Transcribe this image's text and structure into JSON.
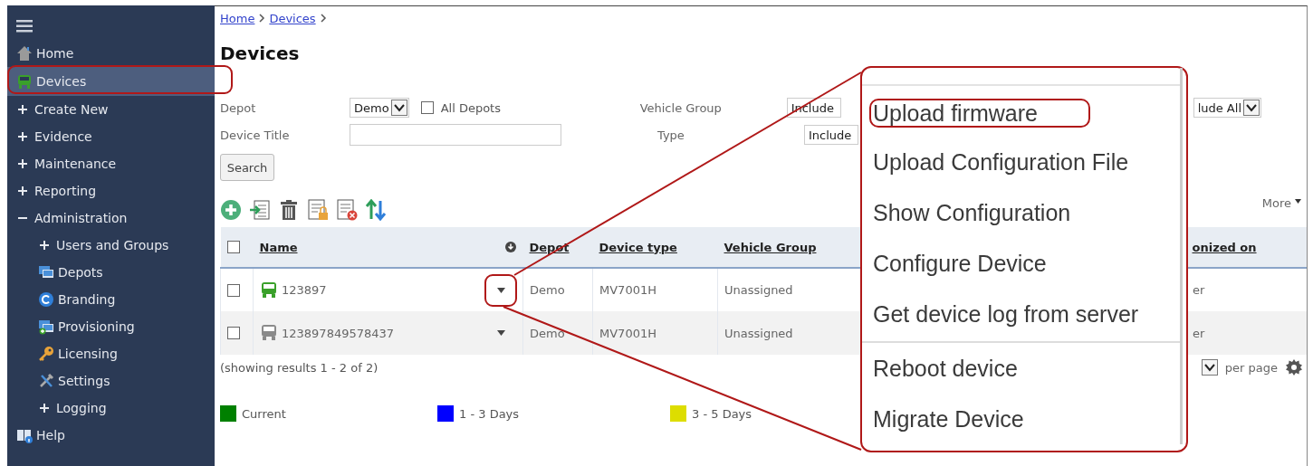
{
  "sidebar": {
    "items": [
      {
        "kind": "page",
        "label": "Home",
        "selected": false
      },
      {
        "kind": "page",
        "label": "Devices",
        "selected": true
      },
      {
        "kind": "folder",
        "label": "Create New",
        "expanded": false,
        "selected": false
      },
      {
        "kind": "folder",
        "label": "Evidence",
        "expanded": false,
        "selected": false
      },
      {
        "kind": "folder",
        "label": "Maintenance",
        "expanded": false,
        "selected": false
      },
      {
        "kind": "folder",
        "label": "Reporting",
        "expanded": false,
        "selected": false
      },
      {
        "kind": "folder",
        "label": "Administration",
        "expanded": true,
        "selected": false,
        "children": [
          {
            "kind": "folder",
            "label": "Users and Groups",
            "expanded": false,
            "selected": false
          },
          {
            "kind": "page",
            "label": "Depots",
            "selected": false
          },
          {
            "kind": "page",
            "label": "Branding",
            "selected": false
          },
          {
            "kind": "page",
            "label": "Provisioning",
            "selected": false
          },
          {
            "kind": "page",
            "label": "Licensing",
            "selected": false
          },
          {
            "kind": "page",
            "label": "Settings",
            "selected": false
          },
          {
            "kind": "folder",
            "label": "Logging",
            "expanded": false,
            "selected": false
          }
        ]
      },
      {
        "kind": "page",
        "label": "Help",
        "selected": false
      }
    ]
  },
  "breadcrumb": [
    {
      "label": "Home"
    },
    {
      "label": "Devices"
    }
  ],
  "title": "Devices",
  "filters": {
    "depot": {
      "label": "Depot",
      "value": "Demo"
    },
    "all_depots": {
      "label": "All Depots",
      "checked": false
    },
    "vehicle_group": {
      "label": "Vehicle Group",
      "value": "Include"
    },
    "device_title": {
      "label": "Device Title"
    },
    "type": {
      "label": "Type",
      "value": "Include"
    },
    "right_select": {
      "value": "lude All"
    }
  },
  "search_button": "Search",
  "more_menu": "More",
  "table": {
    "select_all": {
      "checked": false
    },
    "columns": [
      "Name",
      "Depot",
      "Device type",
      "Vehicle Group",
      "onized on"
    ],
    "rows": [
      {
        "checked": false,
        "color": "#3aa02a",
        "cells": [
          "123897",
          "Demo",
          "MV7001H",
          "Unassigned",
          "er"
        ]
      },
      {
        "checked": false,
        "color": "#8a8a8a",
        "cells": [
          "123897849578437",
          "Demo",
          "MV7001H",
          "Unassigned",
          "er"
        ]
      }
    ]
  },
  "results_text": "(showing results 1 - 2 of 2)",
  "per_page": {
    "label": "per page"
  },
  "legend": [
    {
      "label": "Current",
      "color": "#008000"
    },
    {
      "label": "1 - 3 Days",
      "color": "#0000ff"
    },
    {
      "label": "3 - 5 Days",
      "color": "#dddd00"
    }
  ],
  "callout": {
    "groups": [
      [
        {
          "label": "Upload firmware",
          "highlighted": true
        },
        {
          "label": "Upload Configuration File",
          "highlighted": false
        },
        {
          "label": "Show Configuration",
          "highlighted": false
        },
        {
          "label": "Configure Device",
          "highlighted": false
        },
        {
          "label": "Get device log from server",
          "highlighted": false
        }
      ],
      [
        {
          "label": "Reboot device",
          "highlighted": false
        },
        {
          "label": "Migrate Device",
          "highlighted": false
        }
      ]
    ]
  }
}
